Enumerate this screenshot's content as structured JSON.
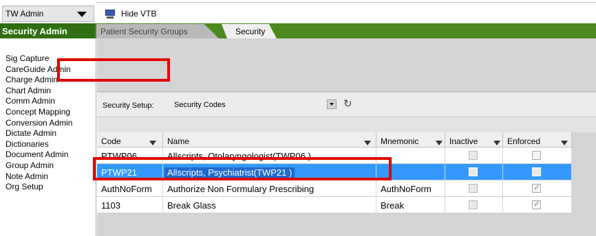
{
  "menubar": {
    "admin_select": "TW Admin",
    "hide_vtb": "Hide VTB"
  },
  "tabs": {
    "section": "Security Admin",
    "patient_security_groups": "Patient Security Groups",
    "security": "Security"
  },
  "sidebar": {
    "items": [
      "Sig Capture",
      "CareGuide Admin",
      "Charge Admin",
      "Chart Admin",
      "Comm Admin",
      "Concept Mapping",
      "Conversion Admin",
      "Dictate Admin",
      "Dictionaries",
      "Document Admin",
      "Group Admin",
      "Note Admin",
      "Org Setup"
    ]
  },
  "setup": {
    "label": "Security Setup:",
    "value": "Security Codes"
  },
  "grid": {
    "headers": {
      "code": "Code",
      "name": "Name",
      "mnemonic": "Mnemonic",
      "inactive": "Inactive",
      "enforced": "Enforced"
    },
    "rows": [
      {
        "code": "PTWP06",
        "name": "Allscripts, Otolaryngologist(TWP06       )",
        "mnemonic": "",
        "inactive": false,
        "enforced": false,
        "selected": false
      },
      {
        "code": "PTWP21",
        "name": "Allscripts, Psychiatrist(TWP21          )",
        "mnemonic": "",
        "inactive": false,
        "enforced": false,
        "selected": true
      },
      {
        "code": "AuthNoForm",
        "name": "Authorize Non Formulary Prescribing",
        "mnemonic": "AuthNoForm",
        "inactive": false,
        "enforced": true,
        "selected": false
      },
      {
        "code": "1103",
        "name": "Break Glass",
        "mnemonic": "Break",
        "inactive": false,
        "enforced": true,
        "selected": false
      }
    ]
  }
}
